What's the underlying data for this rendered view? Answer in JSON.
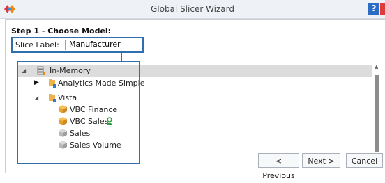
{
  "window": {
    "title": "Global Slicer Wizard",
    "help_label": "?"
  },
  "step": {
    "title": "Step 1 - Choose Model:"
  },
  "slice": {
    "label": "Slice Label:",
    "value": "Manufacturer"
  },
  "tree": {
    "root": {
      "label": "In-Memory"
    },
    "groups": [
      {
        "label": "Analytics Made Simple",
        "children": []
      },
      {
        "label": "Vista",
        "children": [
          {
            "label": "VBC Finance"
          },
          {
            "label": "VBC Sales"
          },
          {
            "label": "Sales"
          },
          {
            "label": "Sales Volume"
          }
        ]
      }
    ]
  },
  "buttons": {
    "previous": "< Previous",
    "next": "Next >",
    "cancel": "Cancel"
  },
  "colors": {
    "accent": "#2f6fb0",
    "selection": "#dcdcdc",
    "help": "#2b6cc4",
    "close": "#e03b3b"
  }
}
